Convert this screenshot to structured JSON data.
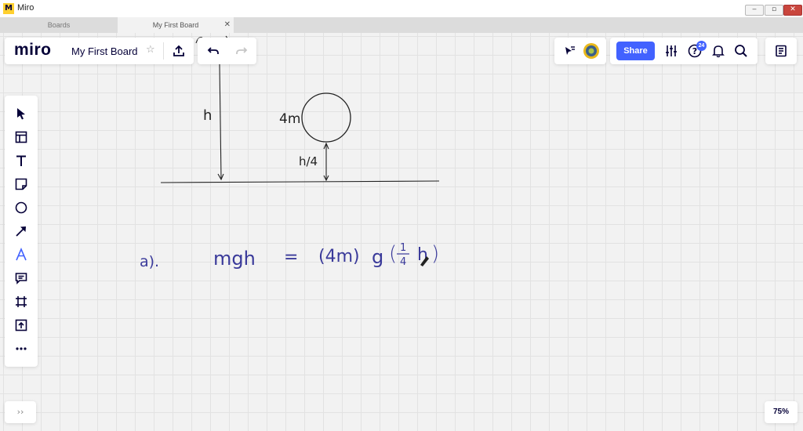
{
  "window": {
    "title": "Miro",
    "icon": "miro-app-icon",
    "minimize": "‒",
    "maximize": "▫",
    "close": "✕"
  },
  "tabs": [
    {
      "label": "Boards",
      "active": false
    },
    {
      "label": "My First Board",
      "active": true,
      "close": "✕"
    }
  ],
  "header": {
    "logo": "miro",
    "board_name": "My First Board",
    "star": "☆",
    "icons": [
      "export-icon",
      "undo-icon",
      "redo-icon"
    ]
  },
  "right_header": {
    "share_label": "Share",
    "notification_count": "24",
    "icons": [
      "presenter-cursor-icon",
      "avatar",
      "settings-sliders-icon",
      "help-icon",
      "bell-icon",
      "search-icon",
      "notes-icon"
    ]
  },
  "toolbar": {
    "items": [
      "select-icon",
      "templates-icon",
      "text-icon",
      "sticky-note-icon",
      "shape-icon",
      "arrow-icon",
      "pen-icon",
      "comment-icon",
      "frame-icon",
      "upload-icon",
      "more-icon"
    ]
  },
  "footer": {
    "zoom": "75%",
    "expand": "››"
  },
  "board": {
    "height_label": "h",
    "mass_label": "4m",
    "quarter_height_label": "h/4",
    "eq_part_label": "a).",
    "eq_left": "mgh",
    "eq_equals": "=",
    "eq_mass": "(4m)",
    "eq_g": "g",
    "eq_frac_num": "1",
    "eq_frac_den": "4",
    "eq_h": "h",
    "ink_color": "#3a3a9a"
  },
  "colors": {
    "accent": "#4262ff",
    "text_dark": "#050038",
    "canvas": "#f2f2f2"
  }
}
